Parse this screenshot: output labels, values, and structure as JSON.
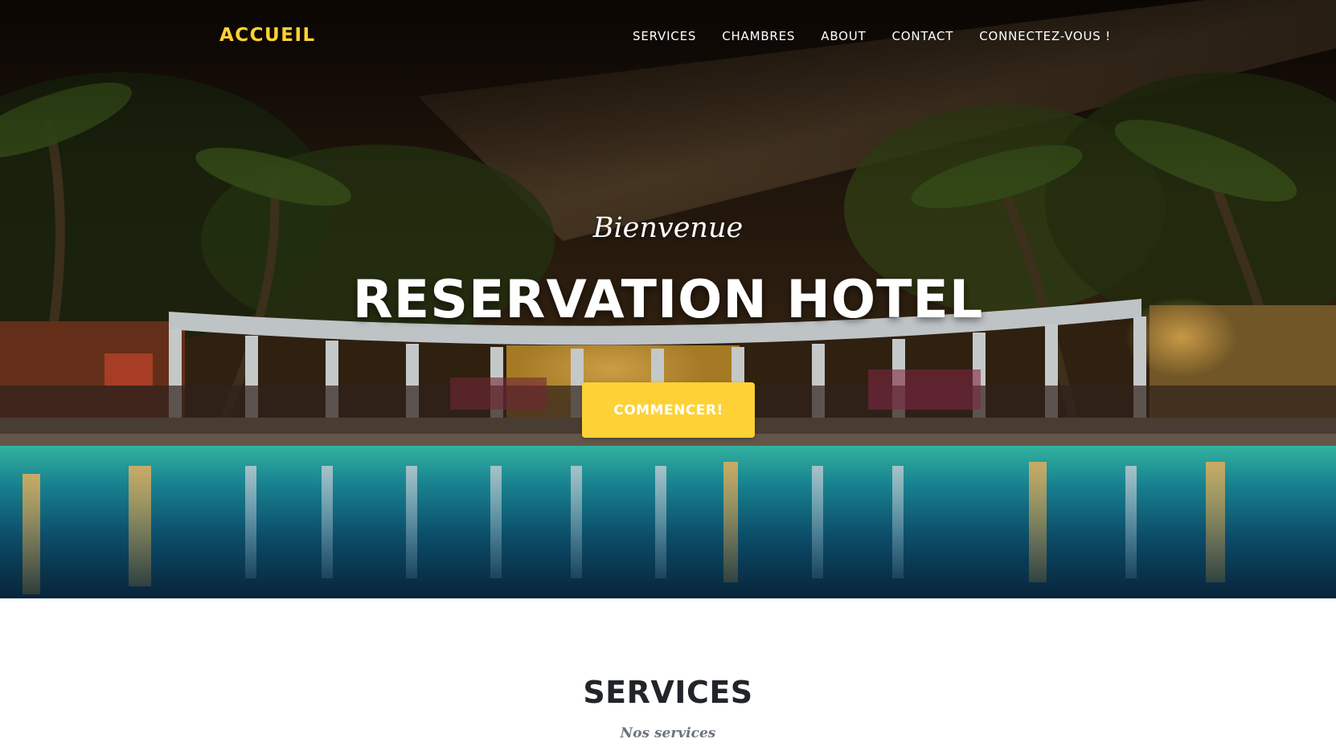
{
  "nav": {
    "brand": "ACCUEIL",
    "links": [
      "SERVICES",
      "CHAMBRES",
      "ABOUT",
      "CONTACT",
      "CONNECTEZ-VOUS !"
    ]
  },
  "hero": {
    "subheading": "Bienvenue",
    "heading": "RESERVATION HOTEL",
    "button_label": "COMMENCER!",
    "background_image": "night-hotel-pool-icon"
  },
  "services": {
    "heading": "SERVICES",
    "subheading": "Nos services"
  },
  "colors": {
    "accent": "#fed136",
    "heading_dark": "#212529",
    "muted": "#6c757d"
  }
}
